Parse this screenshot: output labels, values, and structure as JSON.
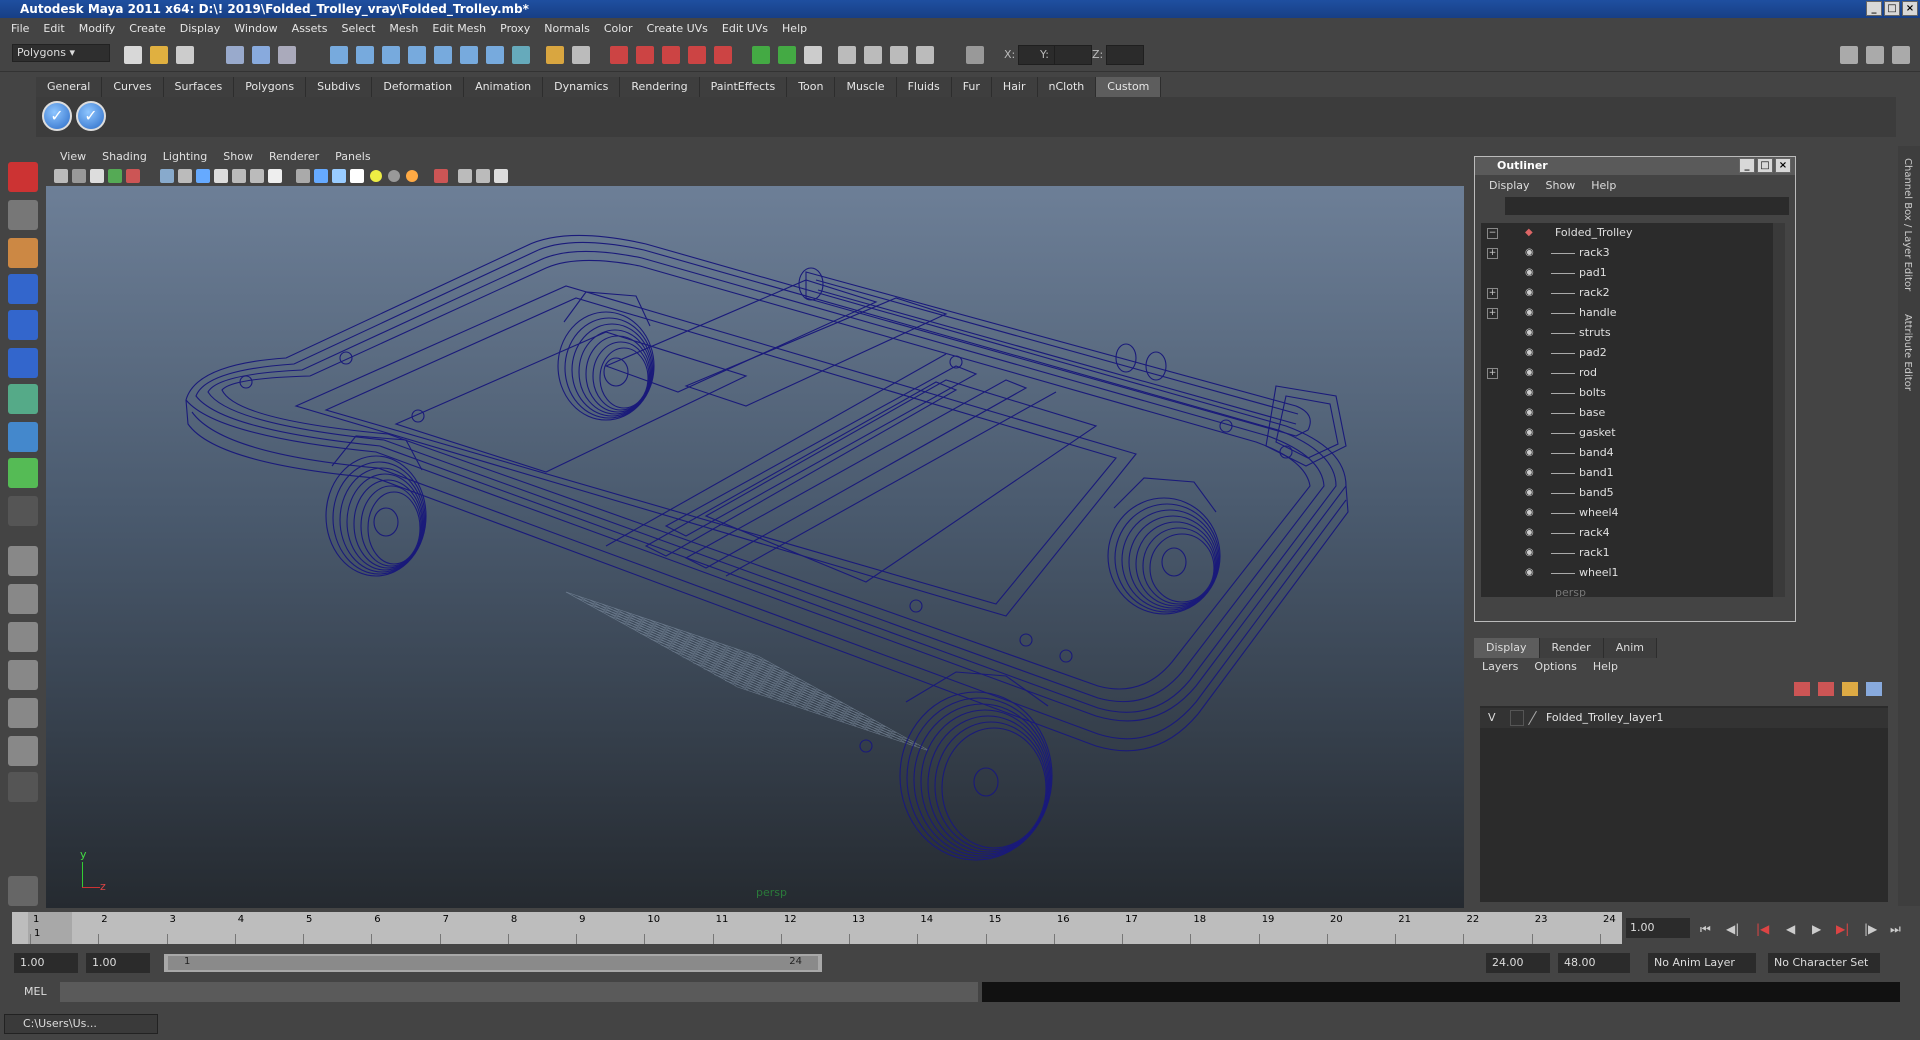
{
  "window": {
    "title": "Autodesk Maya 2011 x64: D:\\! 2019\\Folded_Trolley_vray\\Folded_Trolley.mb*"
  },
  "menu": [
    "File",
    "Edit",
    "Modify",
    "Create",
    "Display",
    "Window",
    "Assets",
    "Select",
    "Mesh",
    "Edit Mesh",
    "Proxy",
    "Normals",
    "Color",
    "Create UVs",
    "Edit UVs",
    "Help"
  ],
  "toolbar": {
    "mode": "Polygons",
    "x_label": "X:",
    "y_label": "Y:",
    "z_label": "Z:"
  },
  "shelf_tabs": [
    "General",
    "Curves",
    "Surfaces",
    "Polygons",
    "Subdivs",
    "Deformation",
    "Animation",
    "Dynamics",
    "Rendering",
    "PaintEffects",
    "Toon",
    "Muscle",
    "Fluids",
    "Fur",
    "Hair",
    "nCloth",
    "Custom"
  ],
  "shelf_active": "Custom",
  "viewport": {
    "menu": [
      "View",
      "Shading",
      "Lighting",
      "Show",
      "Renderer",
      "Panels"
    ],
    "camera_label": "persp",
    "axis_y": "y",
    "axis_z": "z",
    "wire_color": "#1a1a7a"
  },
  "outliner": {
    "title": "Outliner",
    "menu": [
      "Display",
      "Show",
      "Help"
    ],
    "root": "Folded_Trolley",
    "items": [
      {
        "name": "rack3",
        "expandable": true
      },
      {
        "name": "pad1",
        "expandable": false
      },
      {
        "name": "rack2",
        "expandable": true
      },
      {
        "name": "handle",
        "expandable": true
      },
      {
        "name": "struts",
        "expandable": false
      },
      {
        "name": "pad2",
        "expandable": false
      },
      {
        "name": "rod",
        "expandable": true
      },
      {
        "name": "bolts",
        "expandable": false
      },
      {
        "name": "base",
        "expandable": false
      },
      {
        "name": "gasket",
        "expandable": false
      },
      {
        "name": "band4",
        "expandable": false
      },
      {
        "name": "band1",
        "expandable": false
      },
      {
        "name": "band5",
        "expandable": false
      },
      {
        "name": "wheel4",
        "expandable": false
      },
      {
        "name": "rack4",
        "expandable": false
      },
      {
        "name": "rack1",
        "expandable": false
      },
      {
        "name": "wheel1",
        "expandable": false
      }
    ],
    "partial_item": "persp"
  },
  "layer_editor": {
    "tabs": [
      "Display",
      "Render",
      "Anim"
    ],
    "menu": [
      "Layers",
      "Options",
      "Help"
    ],
    "layers": [
      {
        "visible": "V",
        "name": "Folded_Trolley_layer1"
      }
    ]
  },
  "right_tabs": [
    "Channel Box / Layer Editor",
    "Attribute Editor"
  ],
  "timeline": {
    "ticks": [
      "1",
      "2",
      "3",
      "4",
      "5",
      "6",
      "7",
      "8",
      "9",
      "10",
      "11",
      "12",
      "13",
      "14",
      "15",
      "16",
      "17",
      "18",
      "19",
      "20",
      "21",
      "22",
      "23",
      "24"
    ],
    "current_frame_marker": "1",
    "current_frame": "1.00"
  },
  "range": {
    "start_time": "1.00",
    "playback_start": "1.00",
    "slider_start": "1",
    "slider_end": "24",
    "playback_end": "24.00",
    "end_time": "48.00",
    "anim_layer": "No Anim Layer",
    "char_set": "No Character Set"
  },
  "mel": {
    "label": "MEL"
  },
  "taskbar": {
    "item": "C:\\Users\\Us..."
  }
}
